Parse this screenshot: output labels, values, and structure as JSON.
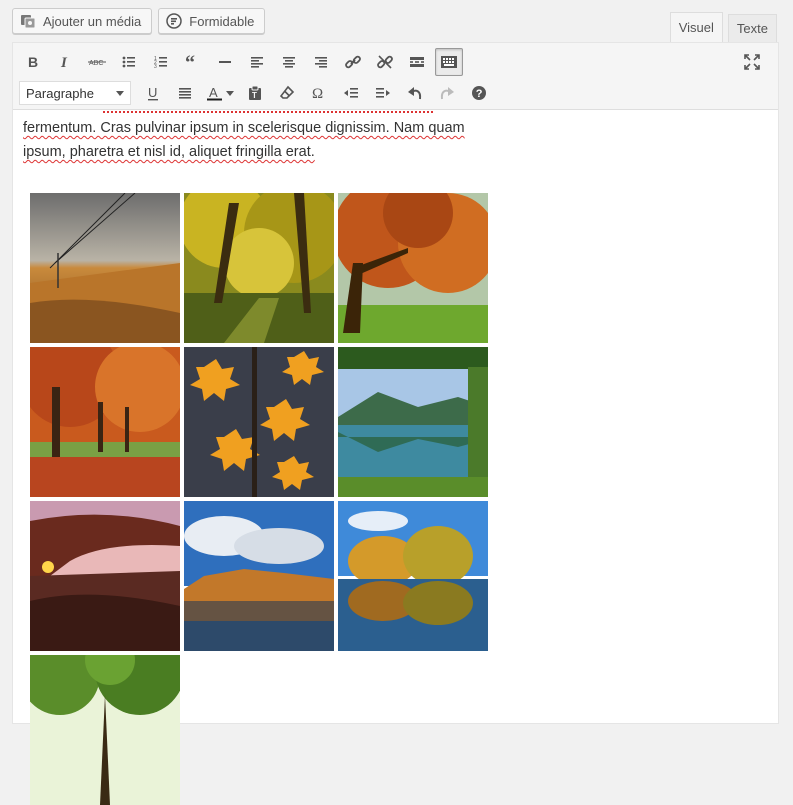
{
  "media_buttons": {
    "add_media": "Ajouter un média",
    "formidable": "Formidable"
  },
  "tabs": {
    "visual": "Visuel",
    "text": "Texte"
  },
  "toolbar": {
    "format_select": "Paragraphe",
    "row1_icons": [
      "bold-icon",
      "italic-icon",
      "strikethrough-icon",
      "bullet-list-icon",
      "numbered-list-icon",
      "blockquote-icon",
      "horizontal-rule-icon",
      "align-left-icon",
      "align-center-icon",
      "align-right-icon",
      "link-icon",
      "unlink-icon",
      "read-more-icon",
      "toolbar-toggle-icon"
    ],
    "row2_icons": [
      "underline-icon",
      "justify-icon",
      "text-color-icon",
      "paste-text-icon",
      "clear-formatting-icon",
      "special-character-icon",
      "outdent-icon",
      "indent-icon",
      "undo-icon",
      "redo-icon",
      "help-icon"
    ],
    "text_color": "#1e1e1e"
  },
  "content": {
    "paragraph_line1": "fermentum. Cras pulvinar ipsum in scelerisque dignissim. Nam quam",
    "paragraph_line2": "ipsum, pharetra et nisl id, aliquet fringilla erat."
  },
  "gallery": {
    "images": [
      "autumn-field-power-lines",
      "autumn-forest-path",
      "orange-tree-meadow",
      "red-autumn-park",
      "orange-maple-leaves",
      "mountain-lake-reflection",
      "arch-sunset",
      "lake-autumn-trees-clouds",
      "autumn-trees-lake-reflection",
      "green-tree-canopy"
    ]
  },
  "colors": {
    "accent": "#0073aa",
    "spellcheck": "#dd3333"
  }
}
